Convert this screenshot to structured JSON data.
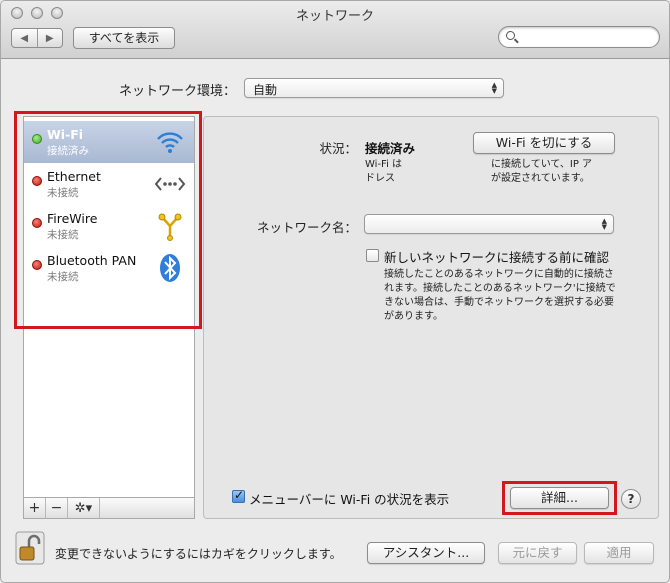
{
  "window": {
    "title": "ネットワーク"
  },
  "toolbar": {
    "back_label": "◀",
    "forward_label": "▶",
    "show_all_label": "すべてを表示",
    "search_placeholder": ""
  },
  "location": {
    "label": "ネットワーク環境：",
    "value": "自動"
  },
  "services": [
    {
      "name": "Wi-Fi",
      "status": "接続済み",
      "state": "connected",
      "icon": "wifi-icon"
    },
    {
      "name": "Ethernet",
      "status": "未接続",
      "state": "disconnected",
      "icon": "ethernet-icon"
    },
    {
      "name": "FireWire",
      "status": "未接続",
      "state": "disconnected",
      "icon": "firewire-icon"
    },
    {
      "name": "Bluetooth PAN",
      "status": "未接続",
      "state": "disconnected",
      "icon": "bluetooth-icon"
    }
  ],
  "sidebar_controls": {
    "add": "+",
    "remove": "−",
    "action": "✲▾"
  },
  "detail": {
    "status_label": "状況：",
    "status_value": "接続済み",
    "wifi_toggle_label": "Wi-Fi を切にする",
    "status_desc_left_1": "Wi-Fi は",
    "status_desc_left_2": "ドレス",
    "status_desc_right_1": "に接続していて、IP ア",
    "status_desc_right_2": "が設定されています。",
    "network_name_label": "ネットワーク名：",
    "network_name_value": "",
    "ask_join_label": "新しいネットワークに接続する前に確認",
    "ask_join_checked": false,
    "ask_join_help": "接続したことのあるネットワークに自動的に接続されます。接続したことのあるネットワーク'に接続できない場合は、手動でネットワークを選択する必要があります。",
    "menubar_label": "メニューバーに Wi-Fi の状況を表示",
    "menubar_checked": true,
    "advanced_label": "詳細...",
    "help_label": "?"
  },
  "bottom": {
    "lock_text": "変更できないようにするにはカギをクリックします。",
    "assistant_label": "アシスタント...",
    "revert_label": "元に戻す",
    "apply_label": "適用"
  },
  "colors": {
    "highlight_box": "#d2181e",
    "selection": "#a9b8d2",
    "connected": "#3da81e",
    "disconnected": "#c3150b"
  }
}
